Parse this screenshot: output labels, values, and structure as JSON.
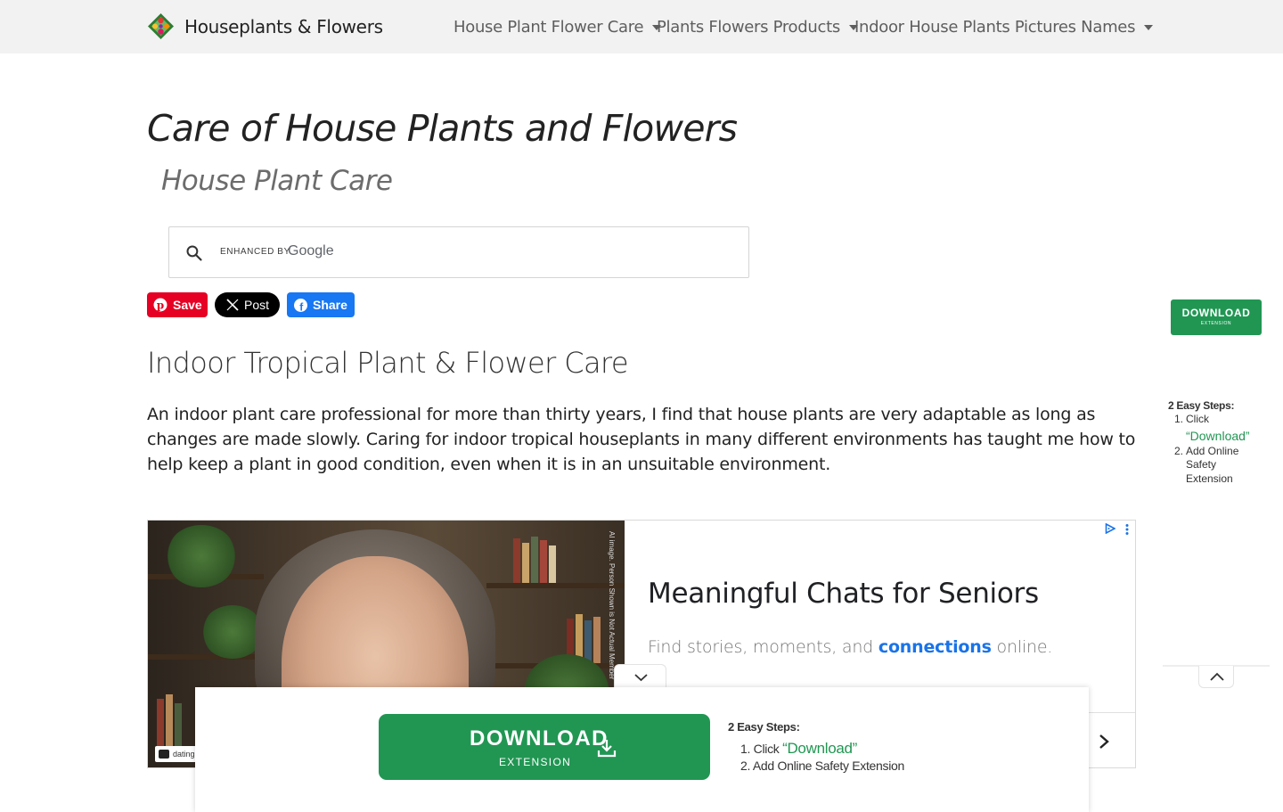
{
  "navbar": {
    "brand": "Houseplants & Flowers",
    "items": [
      {
        "label": "House Plant Flower Care"
      },
      {
        "label": "Plants Flowers Products"
      },
      {
        "label": "Indoor House Plants Pictures Names"
      }
    ]
  },
  "header": {
    "title": "Care of House Plants and Flowers",
    "subtitle": "House Plant Care"
  },
  "search": {
    "enhanced_label": "ENHANCED BY",
    "provider": "Google",
    "value": ""
  },
  "share": {
    "pinterest_label": "Save",
    "x_label": "Post",
    "facebook_label": "Share"
  },
  "content": {
    "heading": "Indoor Tropical Plant & Flower Care",
    "paragraph": "An indoor plant care professional for more than thirty years, I find that house plants are very adaptable as long as changes are made slowly. Caring for indoor tropical houseplants in many different environments has taught me how to help keep a plant in good condition, even when it is in an unsuitable environment."
  },
  "ad": {
    "headline": "Meaningful Chats for Seniors",
    "desc_before": "Find stories, moments, and",
    "desc_highlight": "connections",
    "desc_after": "online.",
    "disclaimer": "AI image. Person Shown is Not Actual Member",
    "brandmark": "dating"
  },
  "extension_banner": {
    "button_title": "DOWNLOAD",
    "button_sub": "EXTENSION",
    "steps_title": "2 Easy Steps:",
    "step1_prefix": "1. Click",
    "step1_quote": "“Download”",
    "step2": "2. Add Online Safety Extension"
  },
  "side_extension": {
    "button_title": "DOWNLOAD",
    "button_sub": "EXTENSION",
    "steps_title": "2 Easy Steps:",
    "step1_num": "1.",
    "step1_text": "Click",
    "step1_quote": "“Download”",
    "step2_num": "2.",
    "step2_line1": "Add Online",
    "step2_line2": "Safety",
    "step2_line3": "Extension"
  },
  "colors": {
    "navbar_bg": "#f2f2f2",
    "download_green": "#219653",
    "pinterest_red": "#e60023",
    "facebook_blue": "#1877f2",
    "link_blue": "#1a73e8"
  },
  "icons": [
    "plant-logo-icon",
    "search-icon",
    "pinterest-icon",
    "x-icon",
    "facebook-icon",
    "adchoices-icon",
    "menu-dots-icon",
    "chevron-right-icon",
    "chevron-down-icon",
    "chevron-up-icon",
    "download-icon"
  ]
}
